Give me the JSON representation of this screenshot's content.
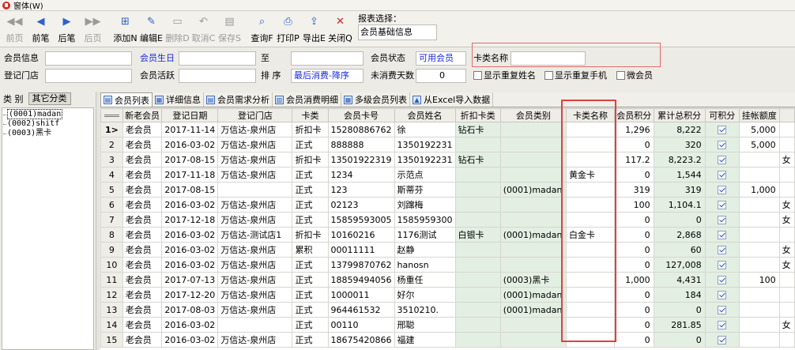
{
  "window": {
    "title": "窗体(W)"
  },
  "toolbar": {
    "buttons": [
      {
        "label": "前页",
        "icon": "first-page-icon",
        "glyph": "◀◀",
        "disabled": true
      },
      {
        "label": "前笔",
        "icon": "prev-record-icon",
        "glyph": "◀",
        "disabled": false
      },
      {
        "label": "后笔",
        "icon": "next-record-icon",
        "glyph": "▶",
        "disabled": false
      },
      {
        "label": "后页",
        "icon": "last-page-icon",
        "glyph": "▶▶",
        "disabled": true
      },
      {
        "label": "添加N",
        "icon": "add-icon",
        "glyph": "⊞",
        "disabled": false
      },
      {
        "label": "编辑E",
        "icon": "edit-icon",
        "glyph": "✎",
        "disabled": false
      },
      {
        "label": "删除D",
        "icon": "delete-icon",
        "glyph": "▭",
        "disabled": true
      },
      {
        "label": "取消C",
        "icon": "undo-icon",
        "glyph": "↶",
        "disabled": true
      },
      {
        "label": "保存S",
        "icon": "save-icon",
        "glyph": "▤",
        "disabled": true
      },
      {
        "label": "查询F",
        "icon": "query-icon",
        "glyph": "⌕",
        "disabled": false
      },
      {
        "label": "打印P",
        "icon": "print-icon",
        "glyph": "⎙",
        "disabled": false
      },
      {
        "label": "导出E",
        "icon": "export-icon",
        "glyph": "⇪",
        "disabled": false
      },
      {
        "label": "关闭Q",
        "icon": "close-icon",
        "glyph": "✕",
        "disabled": false
      }
    ],
    "report_label": "报表选择：",
    "report_value": "会员基础信息"
  },
  "filters": {
    "member_info": "会员信息",
    "register_store": "登记门店",
    "member_birthday": "会员生日",
    "member_active": "会员活跃",
    "to": "至",
    "sort": "排  序",
    "sort_value": "最后消费-降序",
    "member_status": "会员状态",
    "member_status_value": "可用会员",
    "card_type_name": "卡类名称",
    "no_consume_days": "未消费天数",
    "no_consume_value": "0",
    "show_dup_name": "显示重复姓名",
    "show_dup_phone": "显示重复手机",
    "micro_member": "微会员"
  },
  "left": {
    "category": "类 别",
    "other_category": "其它分类",
    "tree": [
      "(0001)madan",
      "(0002)shitf",
      "(0003)黑卡"
    ]
  },
  "tabs": [
    {
      "label": "会员列表",
      "active": true
    },
    {
      "label": "详细信息",
      "active": false
    },
    {
      "label": "会员需求分析",
      "active": false
    },
    {
      "label": "会员消费明细",
      "active": false
    },
    {
      "label": "多级会员列表",
      "active": false
    },
    {
      "label": "从Excel导入数据",
      "active": false
    }
  ],
  "grid": {
    "columns": [
      "",
      "新老会员",
      "登记日期",
      "登记门店",
      "卡类",
      "会员卡号",
      "会员姓名",
      "折扣卡类",
      "会员类别",
      "卡类名称",
      "会员积分",
      "累计总积分",
      "可积分",
      "挂帐额度",
      ""
    ],
    "rows": [
      [
        "1>",
        "老会员",
        "2017-11-14",
        "万信达-泉州店",
        "折扣卡",
        "15280886762",
        "徐",
        "钻石卡",
        "",
        "",
        "1,296",
        "8,222",
        "✓",
        "5,000",
        ""
      ],
      [
        "2",
        "老会员",
        "2016-03-02",
        "万信达-泉州店",
        "正式",
        "888888",
        "1350192231",
        "",
        "",
        "",
        "0",
        "320",
        "✓",
        "5,000",
        ""
      ],
      [
        "3",
        "老会员",
        "2017-08-15",
        "万信达-泉州店",
        "折扣卡",
        "13501922319",
        "1350192231",
        "钻石卡",
        "",
        "",
        "117.2",
        "8,223.2",
        "✓",
        "",
        "女"
      ],
      [
        "4",
        "老会员",
        "2017-11-18",
        "万信达-泉州店",
        "正式",
        "1234",
        "示范点",
        "",
        "",
        "黄金卡",
        "0",
        "1,544",
        "✓",
        "",
        ""
      ],
      [
        "5",
        "老会员",
        "2017-08-15",
        "",
        "正式",
        "123",
        "斯蒂芬",
        "",
        "(0001)madan",
        "",
        "319",
        "319",
        "✓",
        "1,000",
        ""
      ],
      [
        "6",
        "老会员",
        "2016-03-02",
        "万信达-泉州店",
        "正式",
        "02123",
        "刘蹿梅",
        "",
        "",
        "",
        "100",
        "1,104.1",
        "✓",
        "",
        "女"
      ],
      [
        "7",
        "老会员",
        "2017-12-18",
        "万信达-泉州店",
        "正式",
        "15859593005",
        "1585959300",
        "",
        "",
        "",
        "0",
        "0",
        "✓",
        "",
        "女"
      ],
      [
        "8",
        "老会员",
        "2016-03-02",
        "万信达-测试店1",
        "折扣卡",
        "10160216",
        "1176测试",
        "白银卡",
        "(0001)madan",
        "白金卡",
        "0",
        "2,868",
        "✓",
        "",
        ""
      ],
      [
        "9",
        "老会员",
        "2016-03-02",
        "万信达-泉州店",
        "累积",
        "00011111",
        "赵静",
        "",
        "",
        "",
        "0",
        "60",
        "✓",
        "",
        "女"
      ],
      [
        "10",
        "老会员",
        "2016-03-02",
        "万信达-泉州店",
        "正式",
        "13799870762",
        "hanosn",
        "",
        "",
        "",
        "0",
        "127,008",
        "✓",
        "",
        "女"
      ],
      [
        "11",
        "老会员",
        "2017-07-13",
        "万信达-泉州店",
        "正式",
        "18859494056",
        "杨重任",
        "",
        "(0003)黑卡",
        "",
        "1,000",
        "4,431",
        "✓",
        "100",
        ""
      ],
      [
        "12",
        "老会员",
        "2017-12-20",
        "万信达-泉州店",
        "正式",
        "1000011",
        "好尔",
        "",
        "(0001)madan",
        "",
        "0",
        "184",
        "✓",
        "",
        ""
      ],
      [
        "13",
        "老会员",
        "2017-08-03",
        "万信达-泉州店",
        "正式",
        "964461532",
        "3510210.",
        "",
        "(0001)madan",
        "",
        "0",
        "0",
        "✓",
        "",
        ""
      ],
      [
        "14",
        "老会员",
        "2016-03-02",
        "",
        "正式",
        "00110",
        "邢聪",
        "",
        "",
        "",
        "0",
        "281.85",
        "✓",
        "",
        "女"
      ],
      [
        "15",
        "老会员",
        "2016-03-02",
        "万信达-泉州店",
        "正式",
        "18675420866",
        "福建",
        "",
        "",
        "",
        "0",
        "0",
        "✓",
        "",
        ""
      ]
    ]
  }
}
